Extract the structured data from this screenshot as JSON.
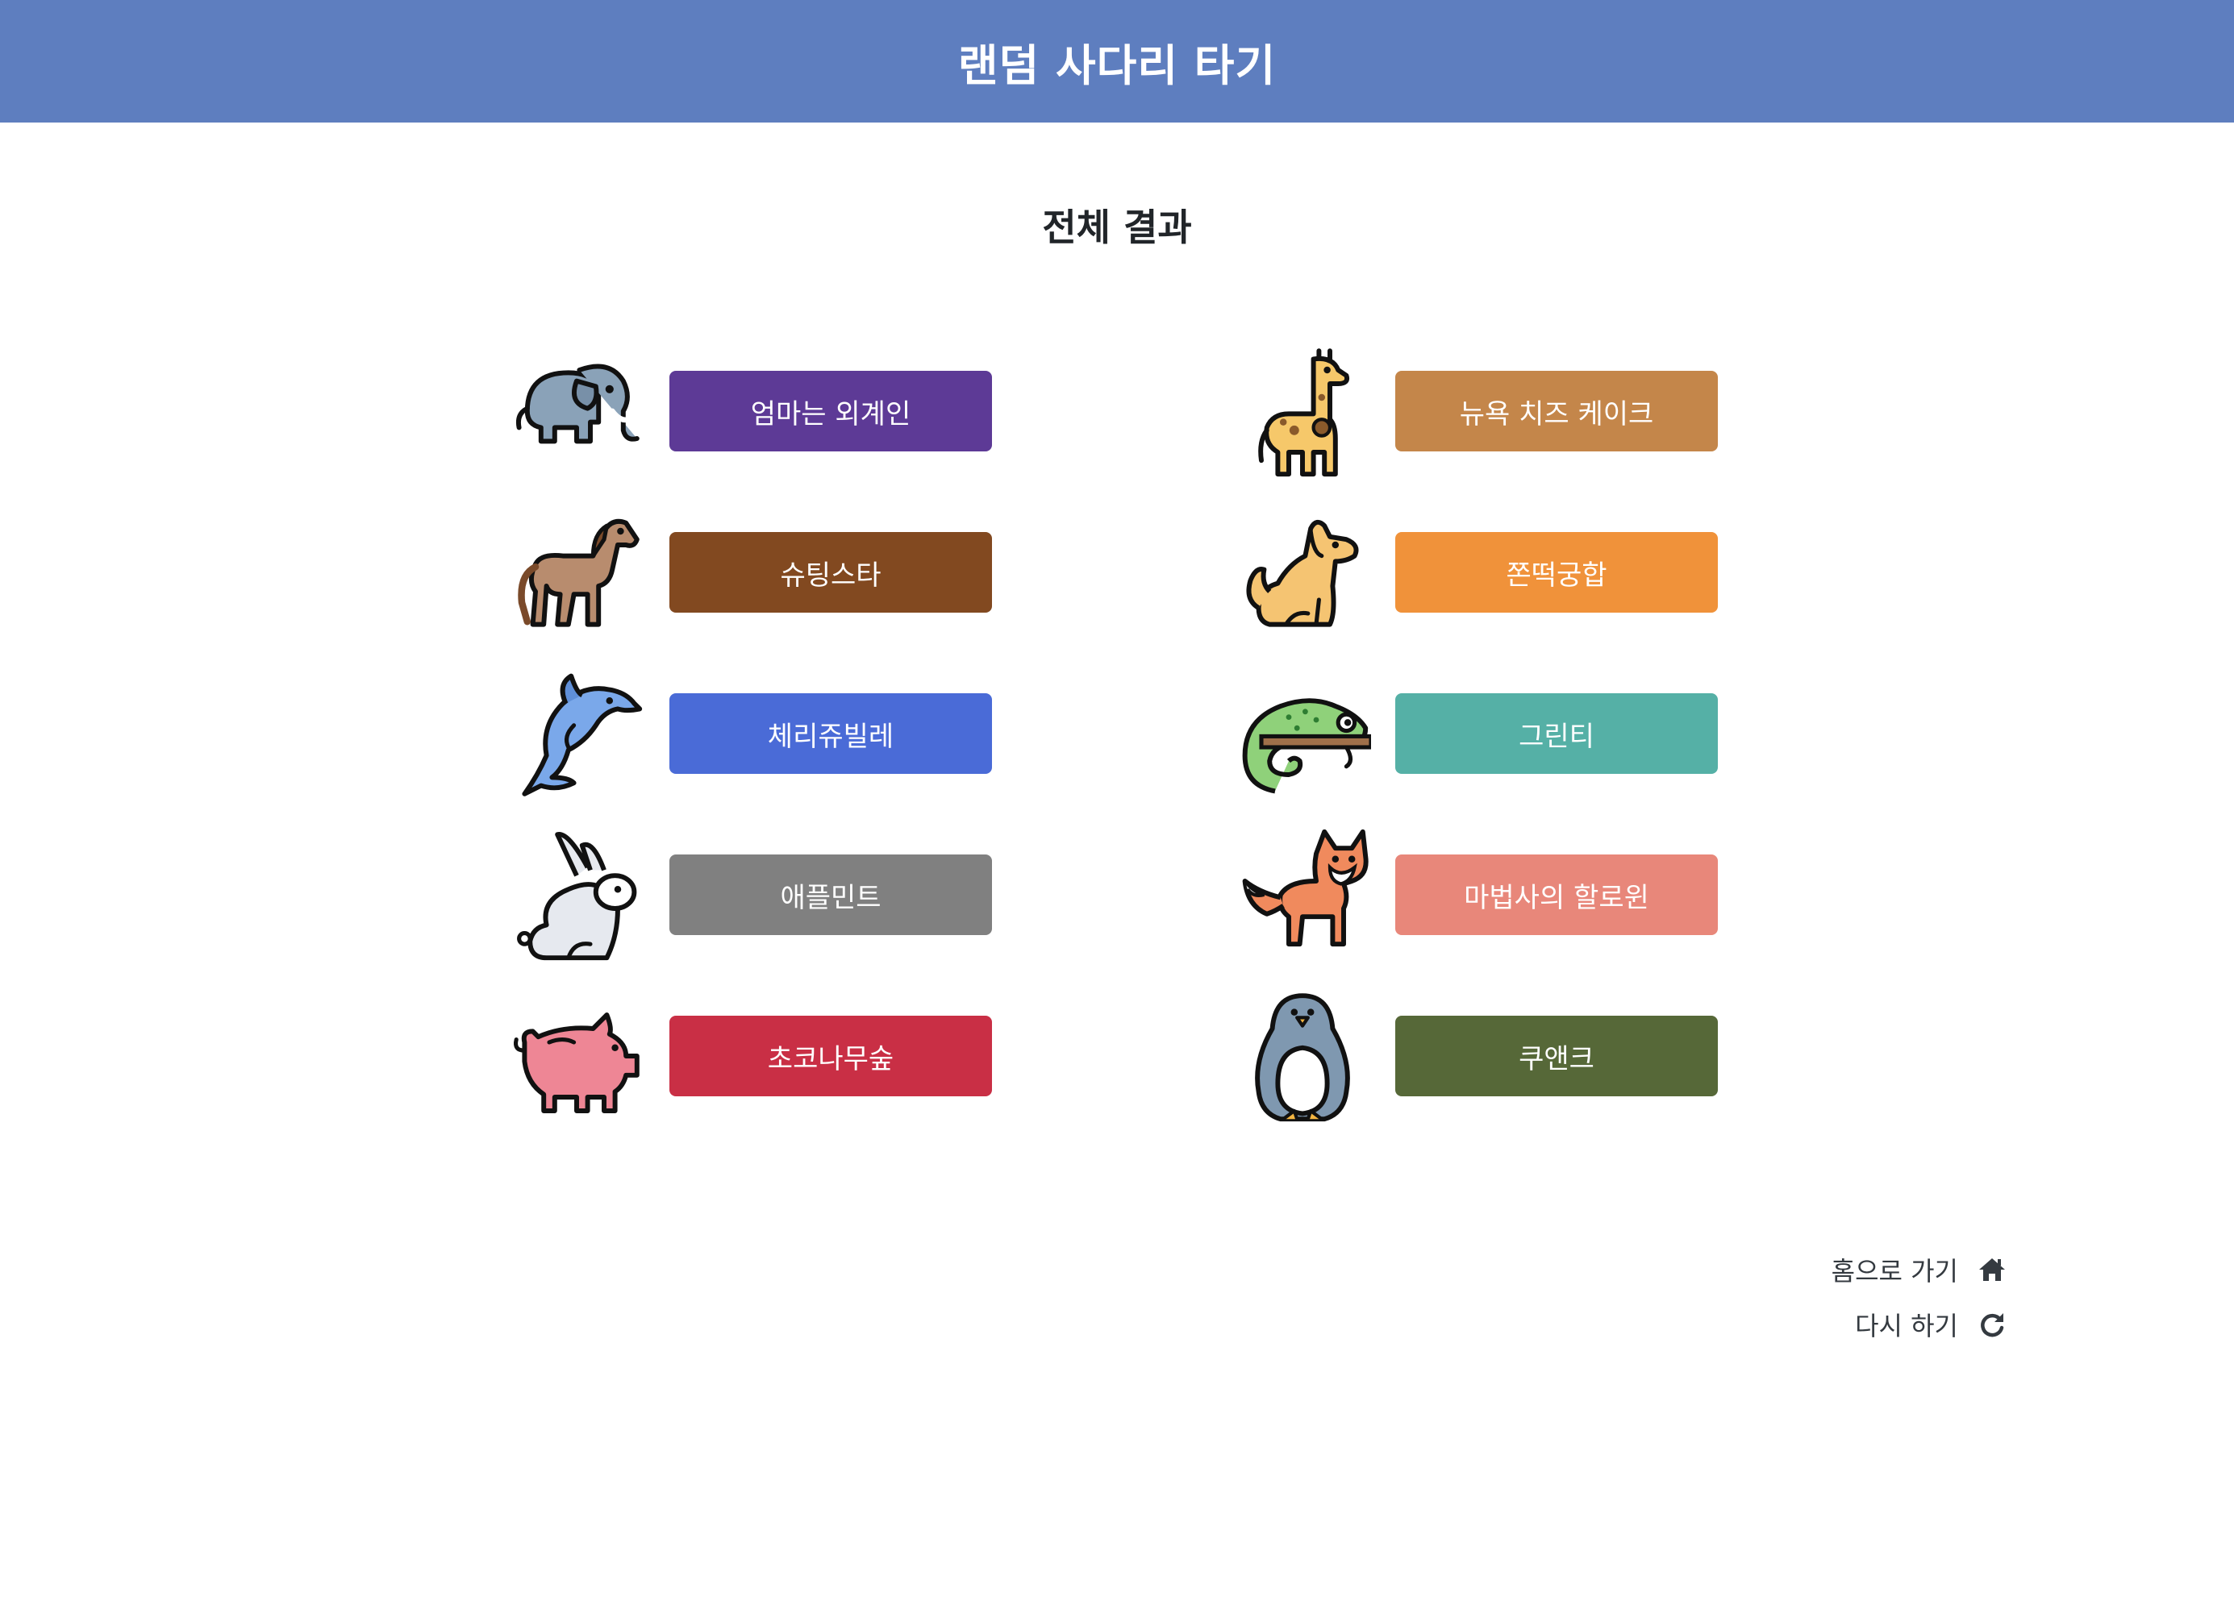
{
  "header": {
    "title": "랜덤 사다리 타기"
  },
  "page": {
    "subtitle": "전체 결과"
  },
  "results": [
    {
      "animal": "elephant-icon",
      "label": "엄마는 외계인",
      "color": "#5d3a96"
    },
    {
      "animal": "giraffe-icon",
      "label": "뉴욕 치즈 케이크",
      "color": "#c4864a"
    },
    {
      "animal": "horse-icon",
      "label": "슈팅스타",
      "color": "#824920"
    },
    {
      "animal": "dog-icon",
      "label": "쫀떡궁합",
      "color": "#f0923a"
    },
    {
      "animal": "dolphin-icon",
      "label": "체리쥬빌레",
      "color": "#4a6bd7"
    },
    {
      "animal": "chameleon-icon",
      "label": "그린티",
      "color": "#55b0a6"
    },
    {
      "animal": "rabbit-icon",
      "label": "애플민트",
      "color": "#808080"
    },
    {
      "animal": "fox-icon",
      "label": "마법사의 할로윈",
      "color": "#e8877a"
    },
    {
      "animal": "pig-icon",
      "label": "초코나무숲",
      "color": "#c92f45"
    },
    {
      "animal": "penguin-icon",
      "label": "쿠앤크",
      "color": "#566838"
    }
  ],
  "links": {
    "home_label": "홈으로 가기",
    "home_icon": "home-icon",
    "retry_label": "다시 하기",
    "retry_icon": "redo-icon"
  }
}
